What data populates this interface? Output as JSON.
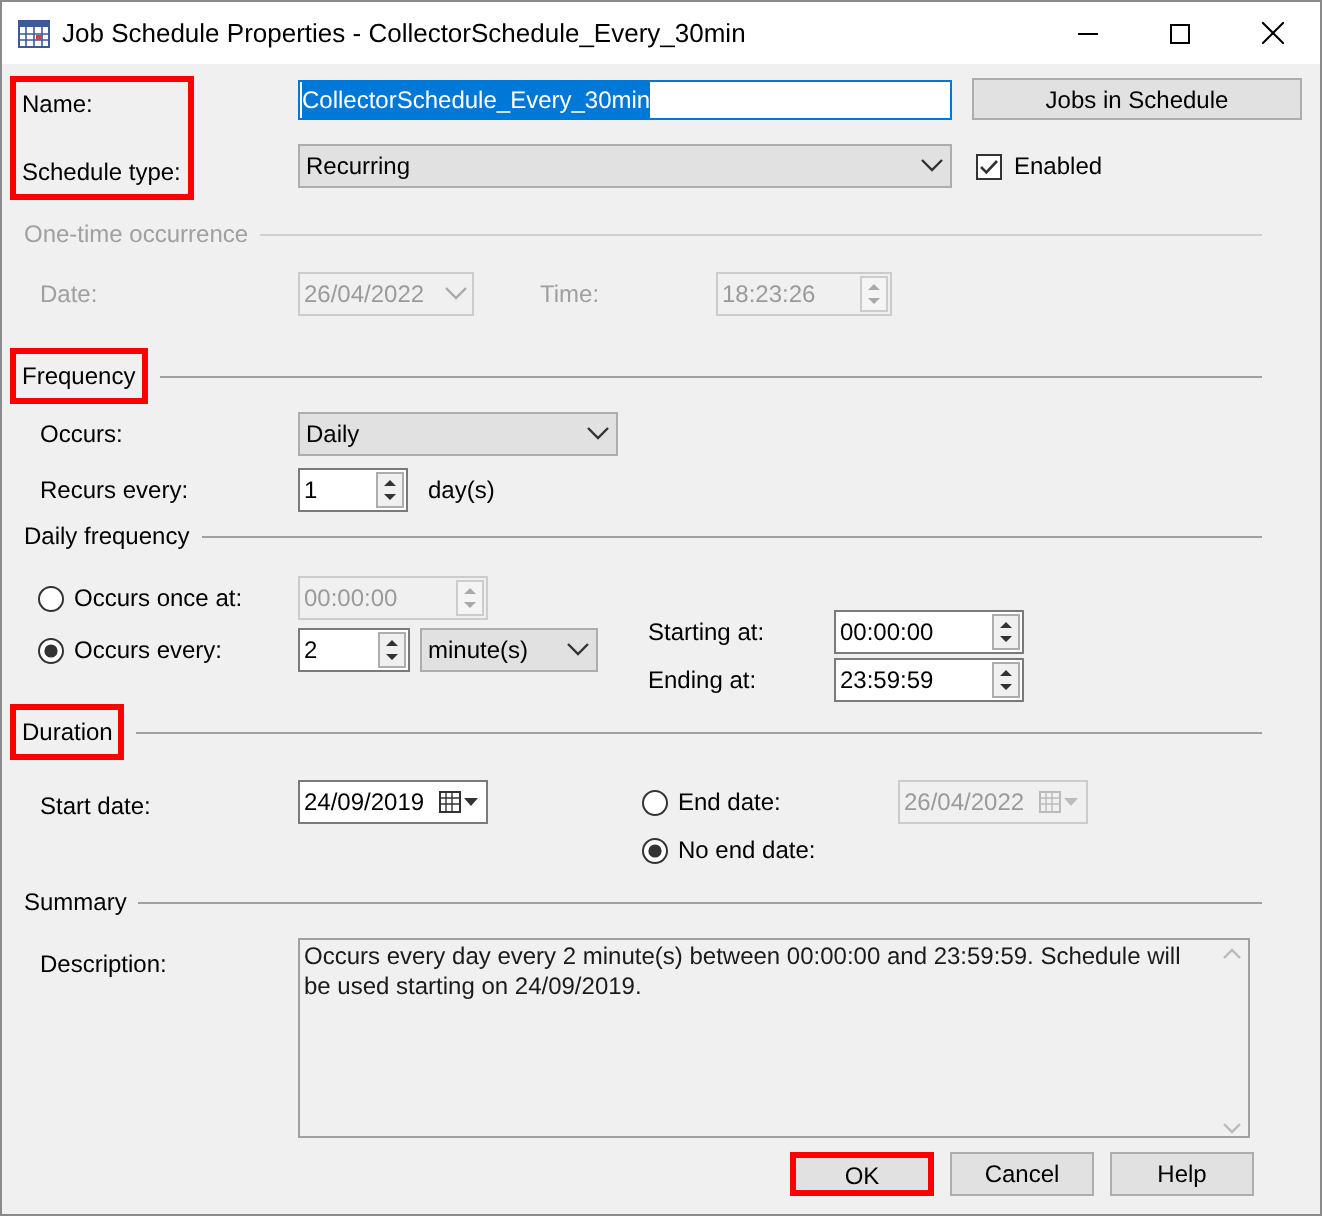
{
  "window": {
    "title": "Job Schedule Properties - CollectorSchedule_Every_30min"
  },
  "name": {
    "label": "Name:",
    "value": "CollectorSchedule_Every_30min",
    "selected": true
  },
  "jobs_button": {
    "label": "Jobs in Schedule"
  },
  "schedule_type": {
    "label": "Schedule type:",
    "value": "Recurring"
  },
  "enabled": {
    "label": "Enabled",
    "checked": true
  },
  "labels_highlighted": true,
  "one_time": {
    "heading": "One-time occurrence",
    "disabled": true,
    "date_label": "Date:",
    "date": "26/04/2022",
    "time_label": "Time:",
    "time": "18:23:26"
  },
  "frequency": {
    "heading": "Frequency",
    "highlighted": true,
    "occurs_label": "Occurs:",
    "occurs": "Daily",
    "recurs_label": "Recurs every:",
    "recurs_value": "1",
    "recurs_unit": "day(s)"
  },
  "daily_frequency": {
    "heading": "Daily frequency",
    "options": [
      {
        "label": "Occurs once at:",
        "selected": false,
        "value": "00:00:00"
      },
      {
        "label": "Occurs every:",
        "selected": true,
        "value": "2",
        "unit": "minute(s)"
      }
    ],
    "starting_label": "Starting at:",
    "starting": "00:00:00",
    "ending_label": "Ending at:",
    "ending": "23:59:59"
  },
  "duration": {
    "heading": "Duration",
    "highlighted": true,
    "start_label": "Start date:",
    "start_date": "24/09/2019",
    "end_options": [
      {
        "label": "End date:",
        "selected": false,
        "value": "26/04/2022"
      },
      {
        "label": "No end date:",
        "selected": true
      }
    ]
  },
  "summary": {
    "heading": "Summary",
    "description_label": "Description:",
    "description": "Occurs every day every 2 minute(s) between 00:00:00 and 23:59:59. Schedule will be used starting on 24/09/2019."
  },
  "buttons": [
    {
      "label": "OK",
      "highlighted": true
    },
    {
      "label": "Cancel",
      "highlighted": false
    },
    {
      "label": "Help",
      "highlighted": false
    }
  ]
}
